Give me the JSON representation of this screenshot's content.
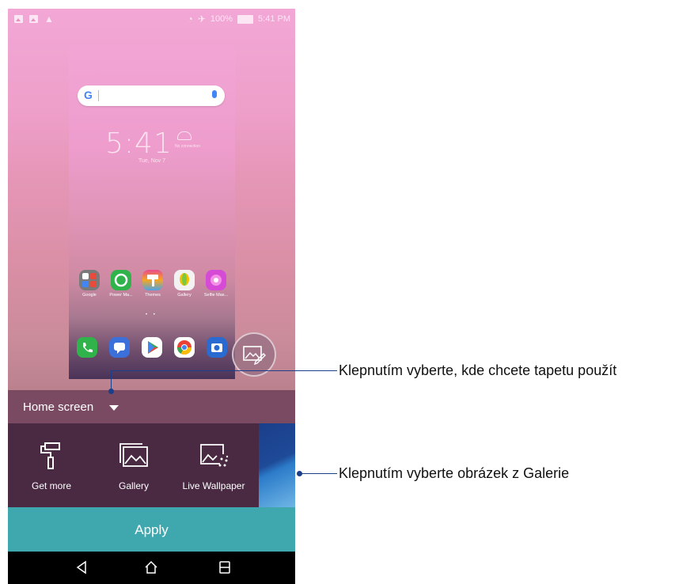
{
  "status_bar": {
    "time": "5:41 PM",
    "battery": "100%",
    "left_icons": [
      "image-icon",
      "image-icon",
      "warning-icon"
    ],
    "right_icons": [
      "alarm-icon",
      "airplane-icon",
      "battery-icon"
    ]
  },
  "preview": {
    "search_logo": "G",
    "clock": "5:41",
    "date": "Tue, Nov 7",
    "weather_text": "No connection",
    "apps": [
      {
        "label": "Google",
        "color": "#7a7a7a"
      },
      {
        "label": "Power Ma...",
        "color": "#2fb34a"
      },
      {
        "label": "Themes",
        "color": "#f5a623"
      },
      {
        "label": "Gallery",
        "color": "#f2f2f2"
      },
      {
        "label": "Selfie Mas...",
        "color": "#d64bd6"
      }
    ],
    "dock": [
      {
        "name": "phone-icon",
        "color": "#2fb34a"
      },
      {
        "name": "messages-icon",
        "color": "#3b6fd9"
      },
      {
        "name": "play-store-icon",
        "color": "#ffffff"
      },
      {
        "name": "chrome-icon",
        "color": "#ffffff"
      },
      {
        "name": "camera-icon",
        "color": "#2a6bd1"
      }
    ]
  },
  "home_selector": {
    "label": "Home screen"
  },
  "tools": {
    "get_more": "Get more",
    "gallery": "Gallery",
    "live_wallpaper": "Live Wallpaper"
  },
  "apply": {
    "label": "Apply"
  },
  "callouts": {
    "where_to_apply": "Klepnutím vyberte, kde chcete tapetu použít",
    "from_gallery": "Klepnutím vyberte obrázek z Galerie"
  },
  "colors": {
    "accent": "#3fa7ae",
    "callout": "#1c3f8c",
    "picker_bg": "#4a2a43"
  }
}
